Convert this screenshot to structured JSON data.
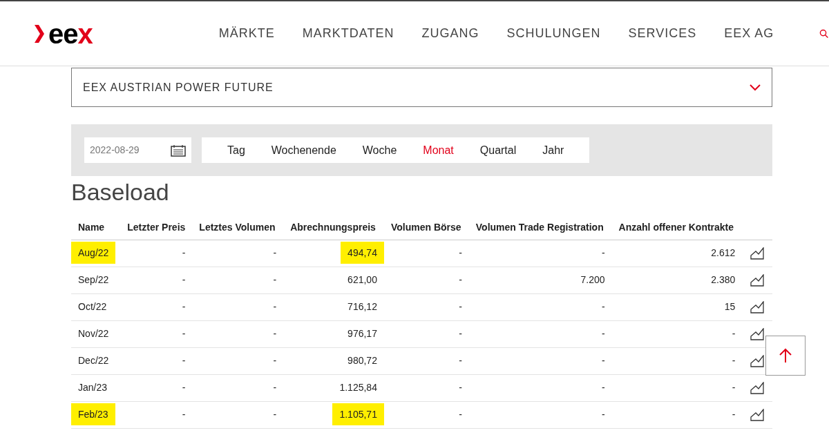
{
  "logo": {
    "dark": "ee",
    "accent": "x"
  },
  "nav": [
    "MÄRKTE",
    "MARKTDATEN",
    "ZUGANG",
    "SCHULUNGEN",
    "SERVICES",
    "EEX AG"
  ],
  "product_select": {
    "value": "EEX AUSTRIAN POWER FUTURE"
  },
  "date_field": {
    "value": "2022-08-29"
  },
  "periods": [
    {
      "label": "Tag",
      "selected": false
    },
    {
      "label": "Wochenende",
      "selected": false
    },
    {
      "label": "Woche",
      "selected": false
    },
    {
      "label": "Monat",
      "selected": true
    },
    {
      "label": "Quartal",
      "selected": false
    },
    {
      "label": "Jahr",
      "selected": false
    }
  ],
  "section_title": "Baseload",
  "table": {
    "columns": [
      "Name",
      "Letzter Preis",
      "Letztes Volumen",
      "Abrechnungspreis",
      "Volumen Börse",
      "Volumen Trade Registration",
      "Anzahl offener Kontrakte"
    ],
    "rows": [
      {
        "cells": [
          {
            "text": "Aug/22",
            "highlighted": true
          },
          {
            "text": "-",
            "highlighted": false
          },
          {
            "text": "-",
            "highlighted": false
          },
          {
            "text": "494,74",
            "highlighted": true
          },
          {
            "text": "-",
            "highlighted": false
          },
          {
            "text": "-",
            "highlighted": false
          },
          {
            "text": "2.612",
            "highlighted": false
          }
        ]
      },
      {
        "cells": [
          {
            "text": "Sep/22",
            "highlighted": false
          },
          {
            "text": "-",
            "highlighted": false
          },
          {
            "text": "-",
            "highlighted": false
          },
          {
            "text": "621,00",
            "highlighted": false
          },
          {
            "text": "-",
            "highlighted": false
          },
          {
            "text": "7.200",
            "highlighted": false
          },
          {
            "text": "2.380",
            "highlighted": false
          }
        ]
      },
      {
        "cells": [
          {
            "text": "Oct/22",
            "highlighted": false
          },
          {
            "text": "-",
            "highlighted": false
          },
          {
            "text": "-",
            "highlighted": false
          },
          {
            "text": "716,12",
            "highlighted": false
          },
          {
            "text": "-",
            "highlighted": false
          },
          {
            "text": "-",
            "highlighted": false
          },
          {
            "text": "15",
            "highlighted": false
          }
        ]
      },
      {
        "cells": [
          {
            "text": "Nov/22",
            "highlighted": false
          },
          {
            "text": "-",
            "highlighted": false
          },
          {
            "text": "-",
            "highlighted": false
          },
          {
            "text": "976,17",
            "highlighted": false
          },
          {
            "text": "-",
            "highlighted": false
          },
          {
            "text": "-",
            "highlighted": false
          },
          {
            "text": "-",
            "highlighted": false
          }
        ]
      },
      {
        "cells": [
          {
            "text": "Dec/22",
            "highlighted": false
          },
          {
            "text": "-",
            "highlighted": false
          },
          {
            "text": "-",
            "highlighted": false
          },
          {
            "text": "980,72",
            "highlighted": false
          },
          {
            "text": "-",
            "highlighted": false
          },
          {
            "text": "-",
            "highlighted": false
          },
          {
            "text": "-",
            "highlighted": false
          }
        ]
      },
      {
        "cells": [
          {
            "text": "Jan/23",
            "highlighted": false
          },
          {
            "text": "-",
            "highlighted": false
          },
          {
            "text": "-",
            "highlighted": false
          },
          {
            "text": "1.125,84",
            "highlighted": false
          },
          {
            "text": "-",
            "highlighted": false
          },
          {
            "text": "-",
            "highlighted": false
          },
          {
            "text": "-",
            "highlighted": false
          }
        ]
      },
      {
        "cells": [
          {
            "text": "Feb/23",
            "highlighted": true
          },
          {
            "text": "-",
            "highlighted": false
          },
          {
            "text": "-",
            "highlighted": false
          },
          {
            "text": "1.105,71",
            "highlighted": true
          },
          {
            "text": "-",
            "highlighted": false
          },
          {
            "text": "-",
            "highlighted": false
          },
          {
            "text": "-",
            "highlighted": false
          }
        ]
      }
    ]
  }
}
